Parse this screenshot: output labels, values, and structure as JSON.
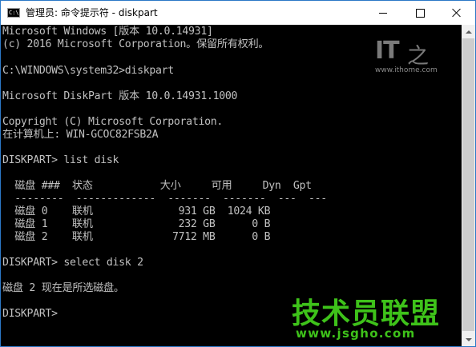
{
  "window": {
    "title": "管理员: 命令提示符 - diskpart",
    "icon_text": "C:\\"
  },
  "titlebar_buttons": {
    "minimize": "minimize-icon",
    "maximize": "maximize-icon",
    "close": "close-icon"
  },
  "console": {
    "lines": [
      "Microsoft Windows [版本 10.0.14931]",
      "(c) 2016 Microsoft Corporation。保留所有权利。",
      "",
      "C:\\WINDOWS\\system32>diskpart",
      "",
      "Microsoft DiskPart 版本 10.0.14931.1000",
      "",
      "Copyright (C) Microsoft Corporation.",
      "在计算机上: WIN-GCOC82FSB2A",
      "",
      "DISKPART> list disk",
      "",
      "  磁盘 ###  状态           大小     可用     Dyn  Gpt",
      "  --------  -------------  -------  -------  ---  ---",
      "  磁盘 0    联机              931 GB  1024 KB",
      "  磁盘 1    联机              232 GB      0 B",
      "  磁盘 2    联机             7712 MB      0 B",
      "",
      "DISKPART> select disk 2",
      "",
      "磁盘 2 现在是所选磁盘。",
      "",
      "DISKPART>"
    ]
  },
  "watermarks": {
    "ithome_logo": "IT",
    "ithome_logo_char": "之",
    "ithome_url": "www.ithome.com",
    "jsgho_brand": "技术员联盟",
    "jsgho_url": "www.jsgho.com"
  },
  "colors": {
    "console_bg": "#000000",
    "console_text": "#c0c0c0",
    "watermark_green": "#3ec21a",
    "title_bg": "#ffffff"
  }
}
